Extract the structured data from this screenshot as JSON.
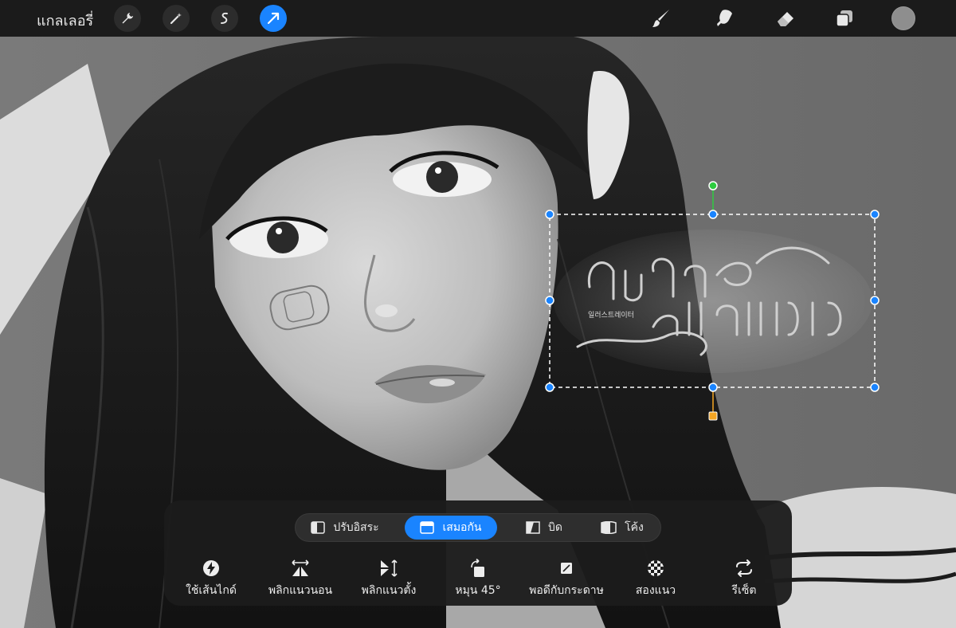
{
  "topbar": {
    "gallery_label": "แกลเลอรี่",
    "left_tools": [
      {
        "name": "actions",
        "icon": "wrench-icon"
      },
      {
        "name": "adjustments",
        "icon": "magic-wand-icon"
      },
      {
        "name": "selection",
        "icon": "selection-s-icon"
      },
      {
        "name": "transform",
        "icon": "transform-arrow-icon",
        "active": true
      }
    ],
    "right_tools": [
      {
        "name": "brush",
        "icon": "brush-icon"
      },
      {
        "name": "smudge",
        "icon": "smudge-icon"
      },
      {
        "name": "eraser",
        "icon": "eraser-icon"
      },
      {
        "name": "layers",
        "icon": "layers-icon"
      }
    ],
    "current_color": "#8e8e8e"
  },
  "artwork": {
    "lettering_korean": "일러스트레이터"
  },
  "colors": {
    "accent": "#1a84ff",
    "rotate_handle": "#2ecc40",
    "pivot_handle": "#f5a623",
    "panel_bg": "#1c1c1c"
  },
  "transform_panel": {
    "modes": [
      {
        "label": "ปรับอิสระ",
        "icon": "freeform-icon",
        "active": false
      },
      {
        "label": "เสมอกัน",
        "icon": "uniform-icon",
        "active": true
      },
      {
        "label": "บิด",
        "icon": "distort-icon",
        "active": false
      },
      {
        "label": "โค้ง",
        "icon": "warp-icon",
        "active": false
      }
    ],
    "actions": [
      {
        "label": "ใช้เส้นไกด์",
        "icon": "snapping-bolt-icon"
      },
      {
        "label": "พลิกแนวนอน",
        "icon": "flip-horizontal-icon"
      },
      {
        "label": "พลิกแนวตั้ง",
        "icon": "flip-vertical-icon"
      },
      {
        "label": "หมุน 45°",
        "icon": "rotate-45-icon"
      },
      {
        "label": "พอดีกับกระดาษ",
        "icon": "fit-to-screen-icon"
      },
      {
        "label": "สองแนว",
        "icon": "interpolation-icon"
      },
      {
        "label": "รีเซ็ต",
        "icon": "reset-icon"
      }
    ]
  }
}
